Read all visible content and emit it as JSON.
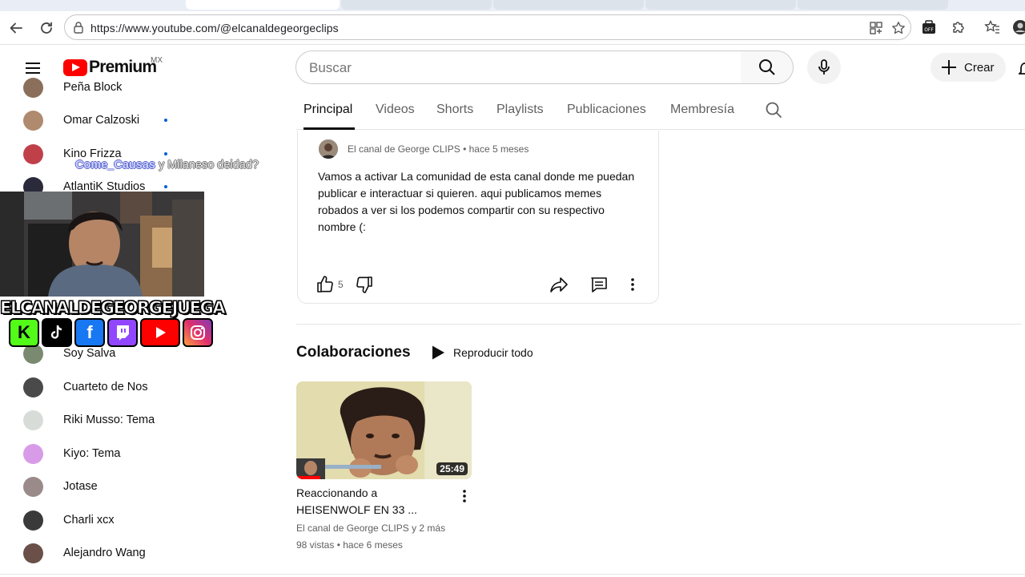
{
  "browser": {
    "url": "https://www.youtube.com/@elcanaldegeorgeclips"
  },
  "header": {
    "logo_text": "Premium",
    "country_code": "MX",
    "search_placeholder": "Buscar",
    "create_label": "Crear"
  },
  "sidebar": {
    "items": [
      {
        "label": "Peña Block",
        "dot": false,
        "avatar_color": "#8b6f5a"
      },
      {
        "label": "Omar Calzoski",
        "dot": true,
        "avatar_color": "#b08a6e"
      },
      {
        "label": "Kino Frizza",
        "dot": true,
        "avatar_color": "#c0404a"
      },
      {
        "label": "AtlantiK Studios",
        "dot": true,
        "avatar_color": "#2a2a3a"
      },
      {
        "label": "Soy Salva",
        "dot": false,
        "avatar_color": "#7a8a70"
      },
      {
        "label": "Cuarteto de Nos",
        "dot": false,
        "avatar_color": "#4a4a4a"
      },
      {
        "label": "Riki Musso: Tema",
        "dot": false,
        "avatar_color": "#d8dcd8"
      },
      {
        "label": "Kiyo: Tema",
        "dot": false,
        "avatar_color": "#d89be8"
      },
      {
        "label": "Jotase",
        "dot": false,
        "avatar_color": "#9a8a8a"
      },
      {
        "label": "Charli xcx",
        "dot": false,
        "avatar_color": "#3a3a3a"
      },
      {
        "label": "Alejandro Wang",
        "dot": false,
        "avatar_color": "#6a5048"
      }
    ]
  },
  "overlay": {
    "streamer_name": "ELCANALDEGEORGEJUEGA",
    "chat_user": "Come_Causas",
    "chat_message": " y Milaneso deidad?",
    "social_icons": [
      "kick-icon",
      "tiktok-icon",
      "facebook-icon",
      "twitch-icon",
      "youtube-icon",
      "instagram-icon"
    ]
  },
  "channel_tabs": [
    {
      "label": "Principal",
      "active": true
    },
    {
      "label": "Videos",
      "active": false
    },
    {
      "label": "Shorts",
      "active": false
    },
    {
      "label": "Playlists",
      "active": false
    },
    {
      "label": "Publicaciones",
      "active": false
    },
    {
      "label": "Membresía",
      "active": false
    }
  ],
  "post": {
    "author": "El canal de George CLIPS",
    "time": "hace 5 meses",
    "text": "Vamos a activar La comunidad de esta canal donde me puedan publicar e interactuar si quieren. aqui publicamos memes robados a ver si los podemos compartir con su respectivo nombre (:",
    "like_count": "5"
  },
  "shelf": {
    "title": "Colaboraciones",
    "play_all": "Reproducir todo",
    "video": {
      "duration": "25:49",
      "title": "Reaccionando a HEISENWOLF EN 33 ...",
      "channel": "El canal de George CLIPS y 2 más",
      "stats": "98 vistas • hace 6 meses"
    }
  }
}
